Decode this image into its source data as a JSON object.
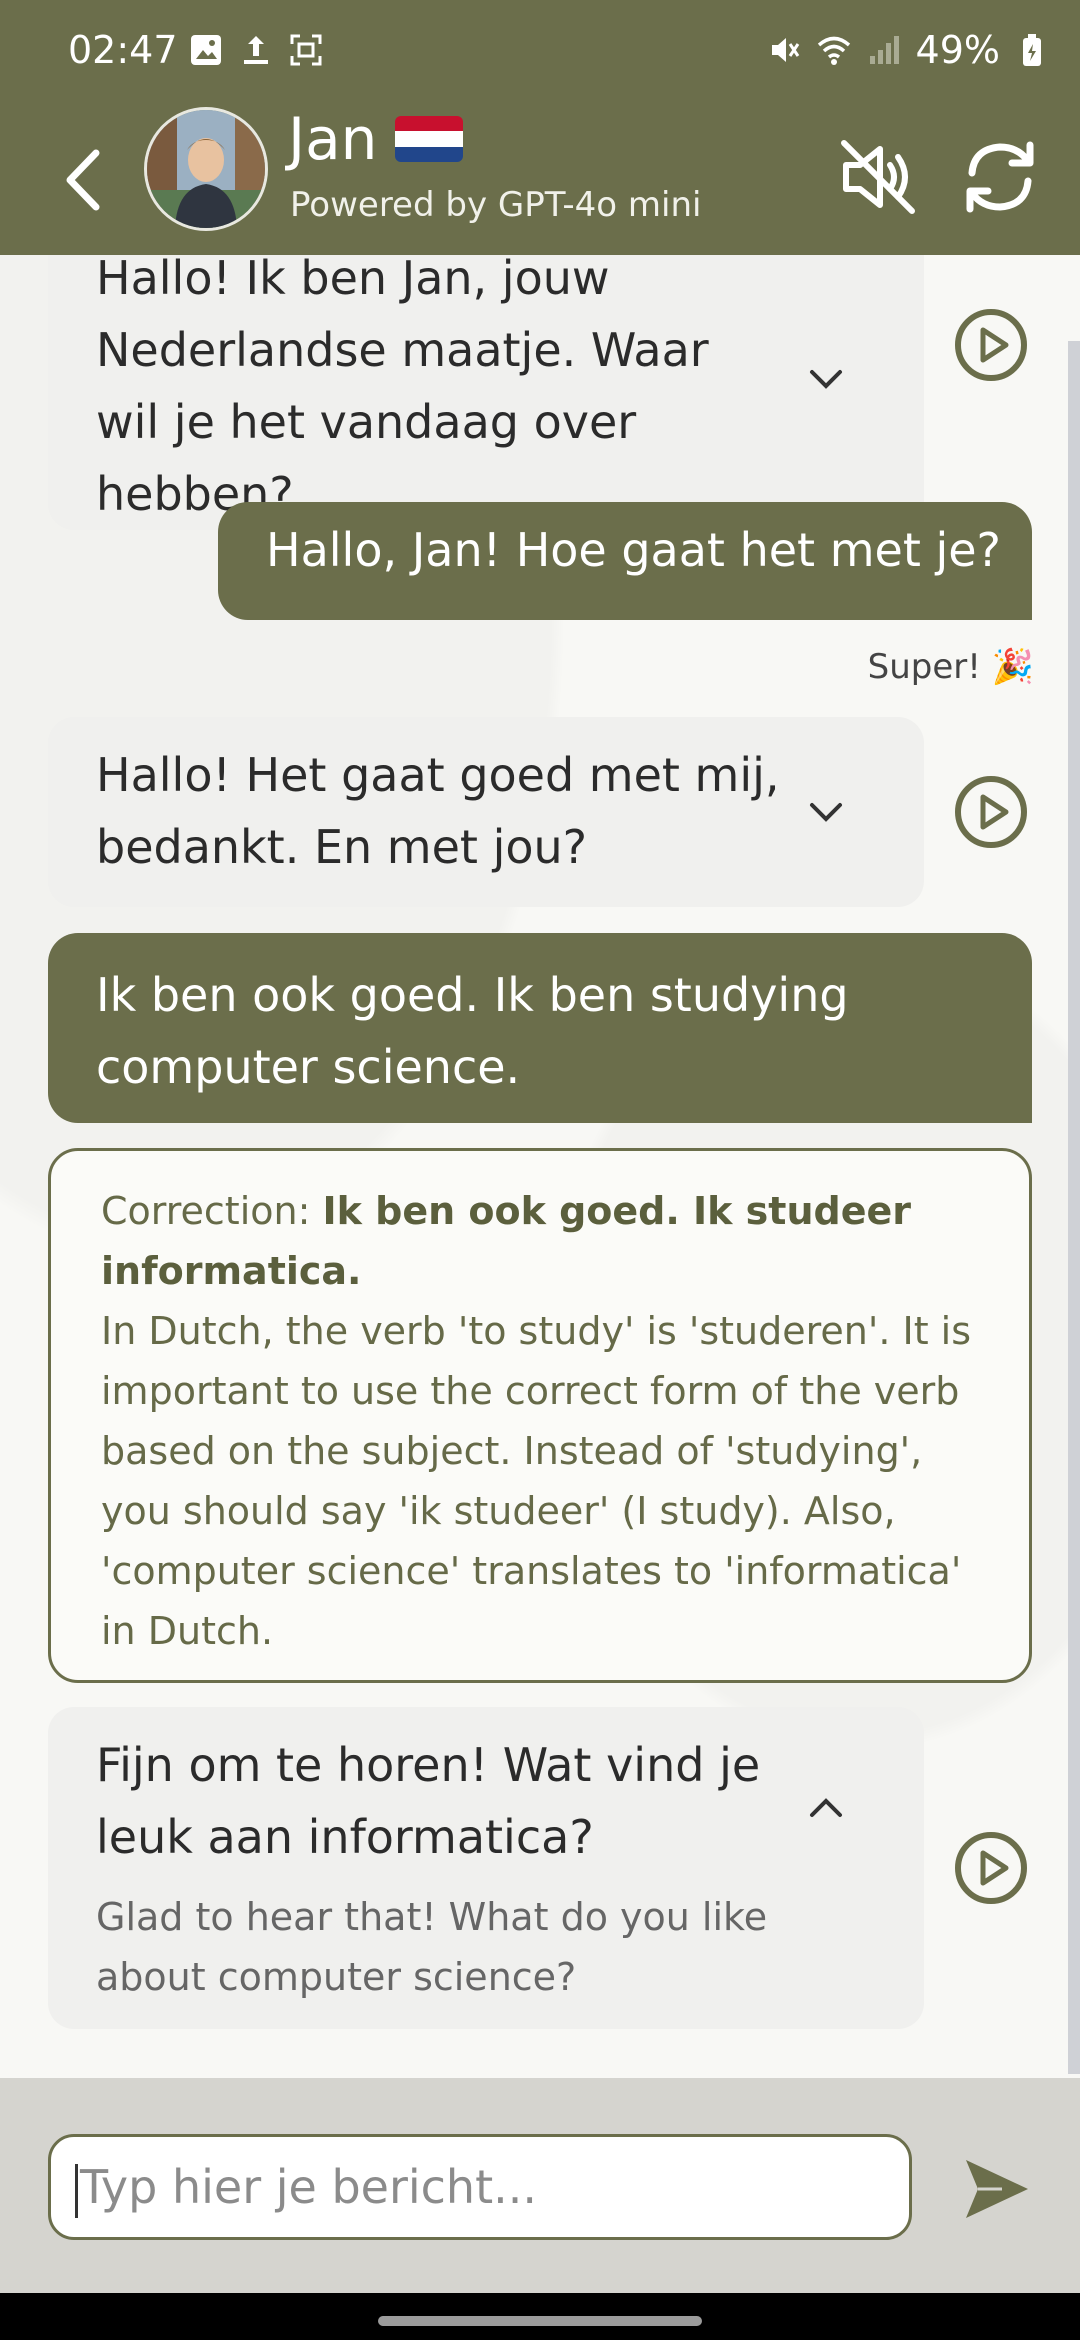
{
  "status": {
    "time": "02:47",
    "battery": "49%"
  },
  "header": {
    "name": "Jan",
    "flag": "🇳🇱",
    "subtitle": "Powered by GPT-4o mini"
  },
  "messages": {
    "ai1": "Hallo! Ik ben Jan, jouw Nederlandse maatje. Waar wil je het vandaag over hebben?",
    "user1": "Hallo, Jan! Hoe gaat het met je?",
    "praise": "Super! 🎉",
    "ai2": "Hallo! Het gaat goed met mij, bedankt. En met jou?",
    "user2": "Ik ben ook goed. Ik ben studying computer science.",
    "correction_label": "Correction:",
    "correction_text": "Ik ben ook goed. Ik studeer informatica.",
    "correction_explanation": "In Dutch, the verb 'to study' is 'studeren'. It is important to use the correct form of the verb based on the subject. Instead of 'studying', you should say 'ik studeer' (I study). Also, 'computer science' translates to 'informatica' in Dutch.",
    "ai3": "Fijn om te horen! Wat vind je leuk aan informatica?",
    "ai3_translation": "Glad to hear that! What do you like about computer science?"
  },
  "input": {
    "placeholder": "Typ hier je bericht..."
  },
  "colors": {
    "brand": "#6b6e4b",
    "ai_bubble": "#f0f0ee",
    "input_bar": "#d5d4cf"
  },
  "icons": [
    "back-arrow-icon",
    "volume-muted-icon",
    "refresh-icon",
    "chevron-down-icon",
    "chevron-up-icon",
    "play-icon",
    "send-icon"
  ]
}
